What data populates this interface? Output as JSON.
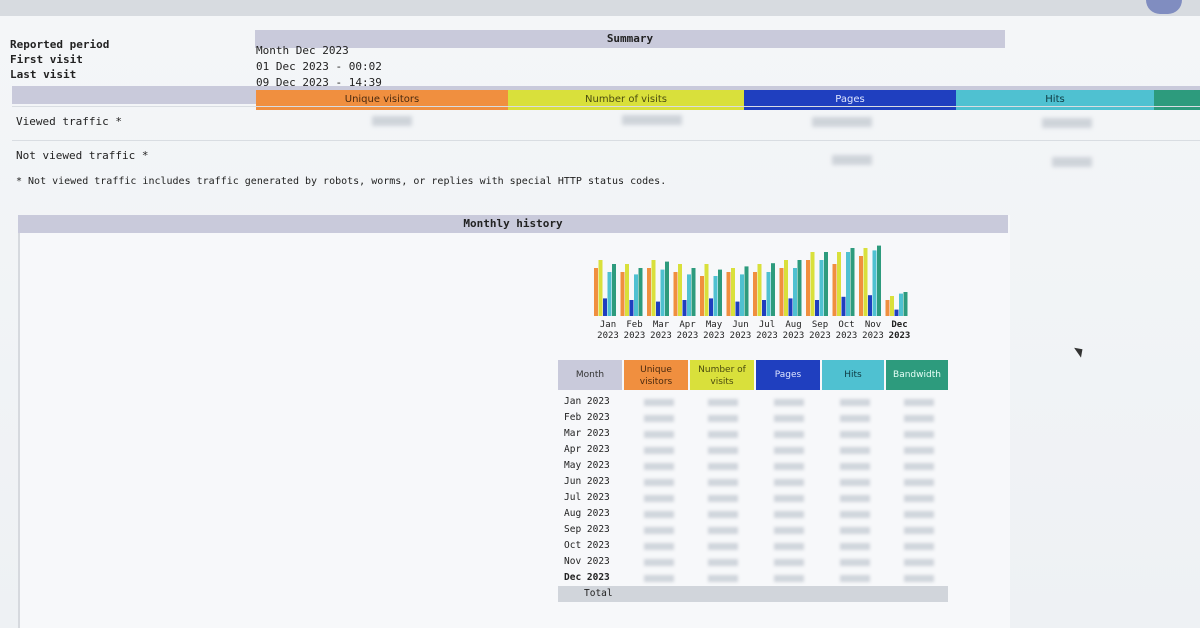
{
  "summary": {
    "title": "Summary",
    "reported_period_label": "Reported period",
    "reported_period_value": "Month Dec 2023",
    "first_visit_label": "First visit",
    "first_visit_value": "01 Dec 2023 - 00:02",
    "last_visit_label": "Last visit",
    "last_visit_value": "09 Dec 2023 - 14:39",
    "columns": [
      "Unique visitors",
      "Number of visits",
      "Pages",
      "Hits"
    ],
    "rows": [
      {
        "label": "Viewed traffic *"
      },
      {
        "label": "Not viewed traffic *"
      }
    ],
    "footnote": "* Not viewed traffic includes traffic generated by robots, worms, or replies with special HTTP status codes."
  },
  "monthly_history": {
    "title": "Monthly history",
    "month_ticks": [
      {
        "m": "Jan",
        "y": "2023"
      },
      {
        "m": "Feb",
        "y": "2023"
      },
      {
        "m": "Mar",
        "y": "2023"
      },
      {
        "m": "Apr",
        "y": "2023"
      },
      {
        "m": "May",
        "y": "2023"
      },
      {
        "m": "Jun",
        "y": "2023"
      },
      {
        "m": "Jul",
        "y": "2023"
      },
      {
        "m": "Aug",
        "y": "2023"
      },
      {
        "m": "Sep",
        "y": "2023"
      },
      {
        "m": "Oct",
        "y": "2023"
      },
      {
        "m": "Nov",
        "y": "2023"
      },
      {
        "m": "Dec",
        "y": "2023"
      }
    ],
    "table_headers": {
      "month": "Month",
      "unique_visitors": "Unique visitors",
      "number_of_visits": "Number of visits",
      "pages": "Pages",
      "hits": "Hits",
      "bandwidth": "Bandwidth"
    },
    "table_rows": [
      "Jan 2023",
      "Feb 2023",
      "Mar 2023",
      "Apr 2023",
      "May 2023",
      "Jun 2023",
      "Jul 2023",
      "Aug 2023",
      "Sep 2023",
      "Oct 2023",
      "Nov 2023",
      "Dec 2023"
    ],
    "total_label": "Total"
  },
  "colors": {
    "unique_visitors": "#f08f3f",
    "visits": "#d9e03b",
    "pages": "#1f3fbf",
    "hits": "#4fc1d1",
    "bandwidth": "#2d9b7d"
  },
  "chart_data": {
    "type": "bar",
    "categories": [
      "Jan 2023",
      "Feb 2023",
      "Mar 2023",
      "Apr 2023",
      "May 2023",
      "Jun 2023",
      "Jul 2023",
      "Aug 2023",
      "Sep 2023",
      "Oct 2023",
      "Nov 2023",
      "Dec 2023"
    ],
    "series": [
      {
        "name": "Unique visitors",
        "values": [
          0.6,
          0.55,
          0.6,
          0.55,
          0.5,
          0.55,
          0.55,
          0.6,
          0.7,
          0.65,
          0.75,
          0.2
        ]
      },
      {
        "name": "Number of visits",
        "values": [
          0.7,
          0.65,
          0.7,
          0.65,
          0.65,
          0.6,
          0.65,
          0.7,
          0.8,
          0.8,
          0.85,
          0.25
        ]
      },
      {
        "name": "Pages",
        "values": [
          0.22,
          0.2,
          0.18,
          0.2,
          0.22,
          0.18,
          0.2,
          0.22,
          0.2,
          0.24,
          0.26,
          0.08
        ]
      },
      {
        "name": "Hits",
        "values": [
          0.55,
          0.52,
          0.58,
          0.52,
          0.5,
          0.52,
          0.55,
          0.6,
          0.7,
          0.8,
          0.82,
          0.28
        ]
      },
      {
        "name": "Bandwidth",
        "values": [
          0.65,
          0.6,
          0.68,
          0.6,
          0.58,
          0.62,
          0.66,
          0.7,
          0.8,
          0.85,
          0.88,
          0.3
        ]
      }
    ],
    "ylim": [
      0,
      1
    ]
  }
}
